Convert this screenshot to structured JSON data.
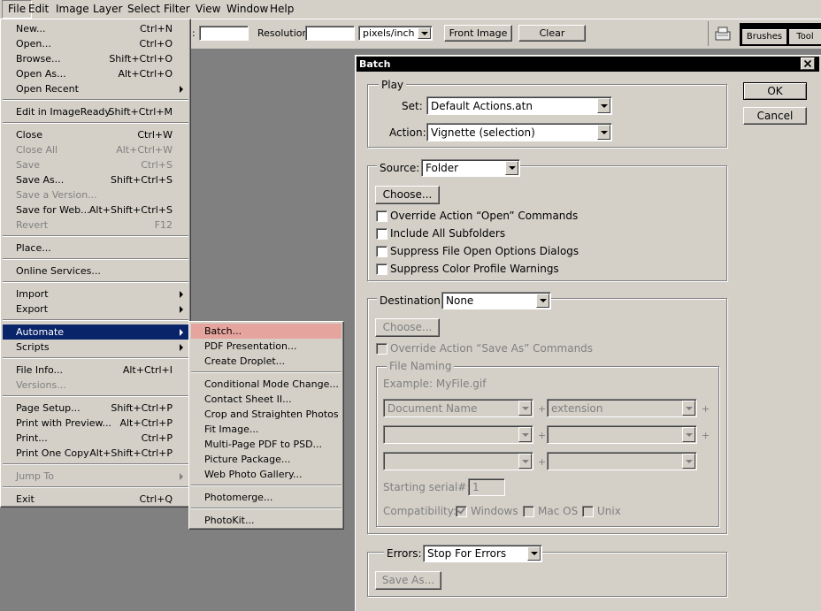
{
  "menubar": [
    "File",
    "Edit",
    "Image",
    "Layer",
    "Select",
    "Filter",
    "View",
    "Window",
    "Help"
  ],
  "options_bar": {
    "colon": ":",
    "resolution_label": "Resolution:",
    "resolution_value": "",
    "units": "pixels/inch",
    "front_image": "Front Image",
    "clear": "Clear",
    "palette_tabs": [
      "Brushes",
      "Tool"
    ]
  },
  "file_menu": {
    "items": [
      {
        "label": "New...",
        "shortcut": "Ctrl+N"
      },
      {
        "label": "Open...",
        "shortcut": "Ctrl+O"
      },
      {
        "label": "Browse...",
        "shortcut": "Shift+Ctrl+O"
      },
      {
        "label": "Open As...",
        "shortcut": "Alt+Ctrl+O"
      },
      {
        "label": "Open Recent",
        "shortcut": ""
      },
      {
        "label": "Edit in ImageReady",
        "shortcut": "Shift+Ctrl+M"
      },
      {
        "label": "Close",
        "shortcut": "Ctrl+W"
      },
      {
        "label": "Close All",
        "shortcut": "Alt+Ctrl+W"
      },
      {
        "label": "Save",
        "shortcut": "Ctrl+S"
      },
      {
        "label": "Save As...",
        "shortcut": "Shift+Ctrl+S"
      },
      {
        "label": "Save a Version...",
        "shortcut": ""
      },
      {
        "label": "Save for Web...",
        "shortcut": "Alt+Shift+Ctrl+S"
      },
      {
        "label": "Revert",
        "shortcut": "F12"
      },
      {
        "label": "Place...",
        "shortcut": ""
      },
      {
        "label": "Online Services...",
        "shortcut": ""
      },
      {
        "label": "Import",
        "shortcut": ""
      },
      {
        "label": "Export",
        "shortcut": ""
      },
      {
        "label": "Automate",
        "shortcut": ""
      },
      {
        "label": "Scripts",
        "shortcut": ""
      },
      {
        "label": "File Info...",
        "shortcut": "Alt+Ctrl+I"
      },
      {
        "label": "Versions...",
        "shortcut": ""
      },
      {
        "label": "Page Setup...",
        "shortcut": "Shift+Ctrl+P"
      },
      {
        "label": "Print with Preview...",
        "shortcut": "Alt+Ctrl+P"
      },
      {
        "label": "Print...",
        "shortcut": "Ctrl+P"
      },
      {
        "label": "Print One Copy",
        "shortcut": "Alt+Shift+Ctrl+P"
      },
      {
        "label": "Jump To",
        "shortcut": ""
      },
      {
        "label": "Exit",
        "shortcut": "Ctrl+Q"
      }
    ]
  },
  "automate_menu": {
    "items": [
      "Batch...",
      "PDF Presentation...",
      "Create Droplet...",
      "Conditional Mode Change...",
      "Contact Sheet II...",
      "Crop and Straighten Photos",
      "Fit Image...",
      "Multi-Page PDF to PSD...",
      "Picture Package...",
      "Web Photo Gallery...",
      "Photomerge...",
      "PhotoKit..."
    ]
  },
  "batch_dialog": {
    "title": "Batch",
    "ok": "OK",
    "cancel": "Cancel",
    "play": {
      "group": "Play",
      "set_label": "Set:",
      "set_value": "Default Actions.atn",
      "action_label": "Action:",
      "action_value": "Vignette (selection)"
    },
    "source": {
      "label": "Source:",
      "value": "Folder",
      "choose": "Choose...",
      "options": [
        {
          "label": "Override Action “Open” Commands",
          "checked": false
        },
        {
          "label": "Include All Subfolders",
          "checked": false
        },
        {
          "label": "Suppress File Open Options Dialogs",
          "checked": false
        },
        {
          "label": "Suppress Color Profile Warnings",
          "checked": false
        }
      ]
    },
    "destination": {
      "label": "Destination:",
      "value": "None",
      "choose": "Choose...",
      "override": "Override Action “Save As” Commands",
      "file_naming": "File Naming",
      "example": "Example: MyFile.gif",
      "naming_row1": [
        "Document Name",
        "extension"
      ],
      "plus": "+",
      "serial_label": "Starting serial#:",
      "serial_value": "1",
      "compat_label": "Compatibility:",
      "compat": [
        {
          "label": "Windows",
          "checked": true
        },
        {
          "label": "Mac OS",
          "checked": false
        },
        {
          "label": "Unix",
          "checked": false
        }
      ]
    },
    "errors": {
      "label": "Errors:",
      "value": "Stop For Errors",
      "save_as": "Save As..."
    }
  }
}
